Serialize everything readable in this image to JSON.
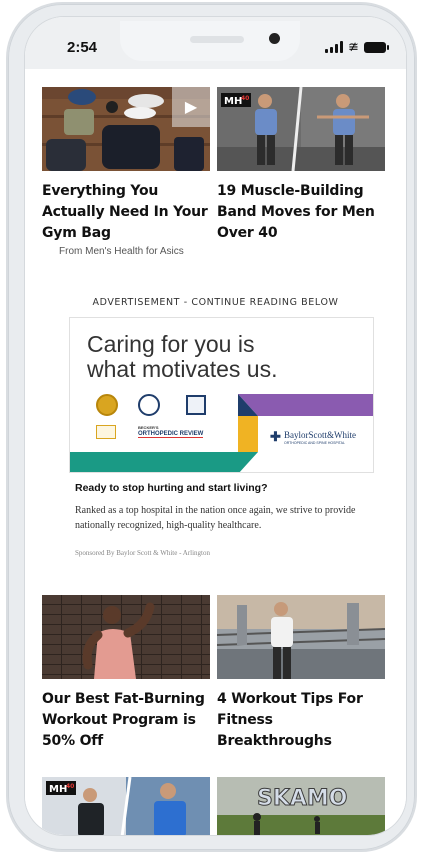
{
  "status_bar": {
    "time": "2:54"
  },
  "cards_top": [
    {
      "title": "Everything You Actually Need In Your Gym Bag",
      "subtitle": "From Men's Health for Asics",
      "thumb_icon": "play-icon"
    },
    {
      "title": "19 Muscle-Building Band Moves for Men Over 40",
      "thumb_logo": "MH40"
    }
  ],
  "advertisement": {
    "label": "ADVERTISEMENT - CONTINUE READING BELOW",
    "headline_line1": "Caring for you is",
    "headline_line2": "what motivates us.",
    "badge_review": "ORTHOPEDIC REVIEW",
    "badge_review_pre": "BECKER'S",
    "brand": "BaylorScott&White",
    "brand_sub": "ORTHOPEDIC AND SPINE HOSPITAL",
    "question": "Ready to stop hurting and start living?",
    "body": "Ranked as a top hospital in the nation once again, we strive to provide nationally recognized, high-quality healthcare.",
    "sponsor": "Sponsored By Baylor Scott & White - Arlington",
    "colors": {
      "purple": "#8a5bb0",
      "gold": "#f0b323",
      "teal": "#1a9a85",
      "navy": "#1f3d6b"
    }
  },
  "cards_bottom": [
    {
      "title": "Our Best Fat-Burning Workout Program is 50% Off"
    },
    {
      "title": "4 Workout Tips For Fitness Breakthroughs"
    }
  ],
  "cards_peek": [
    {
      "thumb_logo": "MH40"
    },
    {
      "thumb_logo": "SKAMO"
    }
  ]
}
